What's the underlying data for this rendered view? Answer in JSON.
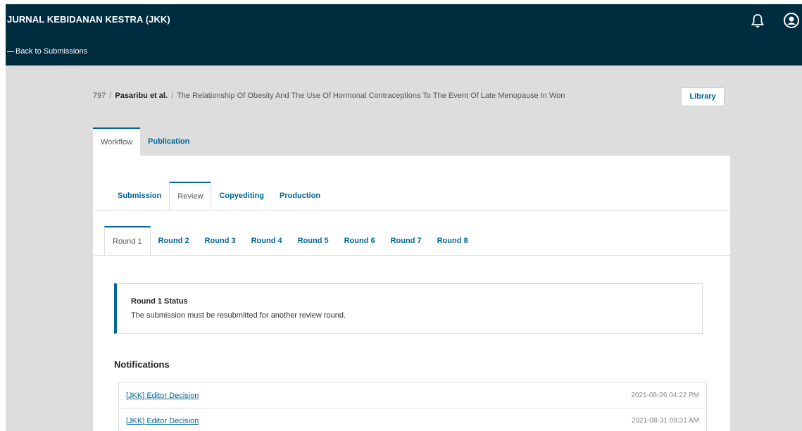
{
  "header": {
    "journal_title": "JURNAL KEBIDANAN KESTRA (JKK)",
    "back_link": "Back to Submissions"
  },
  "breadcrumb": {
    "id": "797",
    "authors": "Pasaribu et al.",
    "title": "The Relationship Of Obesity And The Use Of Hormonal Contraceptions To The Event Of Late Menopause In Won",
    "library_label": "Library"
  },
  "top_tabs": [
    {
      "label": "Workflow",
      "active": true
    },
    {
      "label": "Publication",
      "active": false
    }
  ],
  "stage_tabs": [
    {
      "label": "Submission",
      "active": false
    },
    {
      "label": "Review",
      "active": true
    },
    {
      "label": "Copyediting",
      "active": false
    },
    {
      "label": "Production",
      "active": false
    }
  ],
  "round_tabs": [
    {
      "label": "Round 1",
      "active": true
    },
    {
      "label": "Round 2",
      "active": false
    },
    {
      "label": "Round 3",
      "active": false
    },
    {
      "label": "Round 4",
      "active": false
    },
    {
      "label": "Round 5",
      "active": false
    },
    {
      "label": "Round 6",
      "active": false
    },
    {
      "label": "Round 7",
      "active": false
    },
    {
      "label": "Round 8",
      "active": false
    }
  ],
  "status": {
    "title": "Round 1 Status",
    "text": "The submission must be resubmitted for another review round."
  },
  "notifications": {
    "heading": "Notifications",
    "items": [
      {
        "label": "[JKK] Editor Decision",
        "date": "2021-08-26 04:22 PM"
      },
      {
        "label": "[JKK] Editor Decision",
        "date": "2021-08-31 09:31 AM"
      }
    ]
  },
  "colors": {
    "header_bg": "#002c40",
    "accent": "#006798"
  }
}
